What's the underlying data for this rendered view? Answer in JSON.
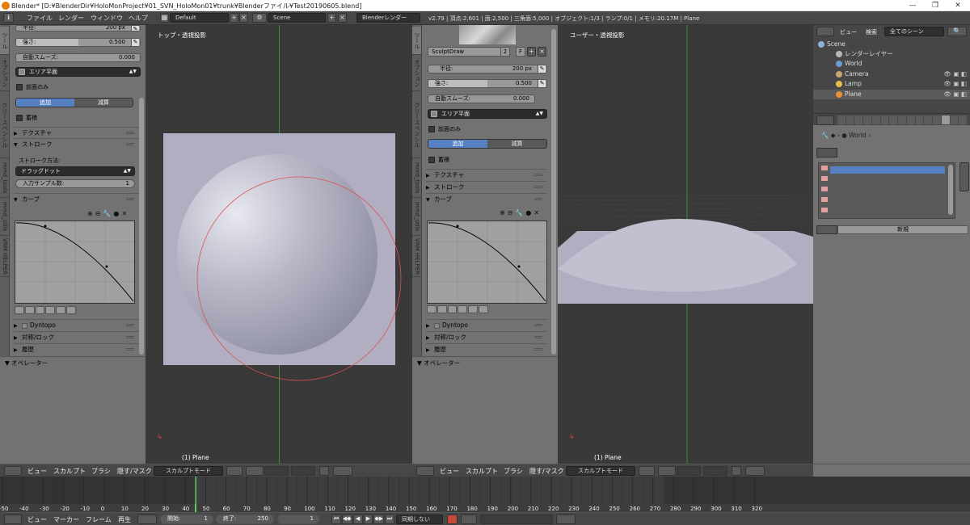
{
  "window": {
    "title": "Blender* [D:¥BlenderDir¥HoloMonProject¥01_SVN_HoloMon01¥trunk¥Blenderファイル¥Test20190605.blend]",
    "min": "—",
    "max": "❐",
    "close": "✕"
  },
  "topbar": {
    "menu": [
      "ファイル",
      "レンダー",
      "ウィンドウ",
      "ヘルプ"
    ],
    "layout": "Default",
    "scene": "Scene",
    "engine": "Blenderレンダー",
    "stats": "v2.79 | 頂点:2,601 | 面:2,500 | 三角面:5,000 | オブジェクト:1/3 | ランプ:0/1 | メモリ:20.17M | Plane"
  },
  "left_tools": {
    "tabs": [
      "ツール",
      "オプション",
      "グリースペンシル",
      "mmd_tools",
      "mmd_utils",
      "VRM HELPER"
    ],
    "radius_label": "半径:",
    "radius_value": "200 px",
    "strength_label": "強さ:",
    "strength_value": "0.500",
    "strength_level": 0.5,
    "smooth_label": "自動スムーズ:",
    "smooth_value": "0.000",
    "area_plane": "エリア平面",
    "front_only": "前面のみ",
    "add": "追加",
    "subtract": "減算",
    "accumulate": "蓄積",
    "texture": "テクスチャ",
    "stroke": "ストローク",
    "stroke_method_label": "ストローク方法:",
    "stroke_method": "ドラッグドット",
    "input_samples_label": "入力サンプル数:",
    "input_samples_value": "1",
    "curve": "カーブ",
    "dyntopo": "Dyntopo",
    "symmetry": "対称/ロック",
    "history": "履歴",
    "operator": "オペレーター"
  },
  "viewport_left": {
    "label": "トップ・透視投影",
    "object": "(1) Plane"
  },
  "mid_tools": {
    "tabs": [
      "ツール",
      "オプション",
      "グリースペンシル",
      "mmd_tools",
      "mmd_utils",
      "VRM HELPER"
    ],
    "brush_name": "SculptDraw",
    "brush_users": "2",
    "brush_f": "F",
    "radius_label": "半径:",
    "radius_value": "200 px",
    "strength_label": "強さ:",
    "strength_value": "0.500",
    "strength_level": 0.5,
    "smooth_label": "自動スムーズ:",
    "smooth_value": "0.000",
    "area_plane": "エリア平面",
    "front_only": "前面のみ",
    "add": "追加",
    "subtract": "減算",
    "accumulate": "蓄積",
    "texture": "テクスチャ",
    "stroke": "ストローク",
    "curve": "カーブ",
    "dyntopo": "Dyntopo",
    "symmetry": "対称/ロック",
    "history": "履歴",
    "operator": "オペレーター"
  },
  "viewport_right": {
    "label": "ユーザー・透視投影",
    "object": "(1) Plane"
  },
  "header_3d": {
    "view": "ビュー",
    "sculpt": "スカルプト",
    "brush": "ブラシ",
    "hide_mask": "隠す/マスク",
    "mode": "スカルプトモード"
  },
  "outliner": {
    "view": "ビュー",
    "search": "検索",
    "filter": "全てのシーン",
    "items": [
      {
        "name": "Scene",
        "color": "#8fb0d8"
      },
      {
        "name": "レンダーレイヤー",
        "color": "#b8b8b8"
      },
      {
        "name": "World",
        "color": "#6b9bd1"
      },
      {
        "name": "Camera",
        "color": "#c9a36c"
      },
      {
        "name": "Lamp",
        "color": "#e0c04a"
      },
      {
        "name": "Plane",
        "color": "#e88e3a"
      }
    ]
  },
  "properties": {
    "breadcrumb": "World",
    "new_button": "新規"
  },
  "timeline": {
    "ticks": [
      "-50",
      "-40",
      "-30",
      "-20",
      "-10",
      "0",
      "10",
      "20",
      "30",
      "40",
      "50",
      "60",
      "70",
      "80",
      "90",
      "100",
      "110",
      "120",
      "130",
      "140",
      "150",
      "160",
      "170",
      "180",
      "190",
      "200",
      "210",
      "220",
      "230",
      "240",
      "250",
      "260",
      "270",
      "280",
      "290",
      "300",
      "310",
      "320"
    ],
    "view": "ビュー",
    "marker": "マーカー",
    "frame": "フレーム",
    "playback": "再生",
    "start_label": "開始:",
    "start_value": "1",
    "end_label": "終了:",
    "end_value": "250",
    "current": "1",
    "sync": "同期しない"
  }
}
